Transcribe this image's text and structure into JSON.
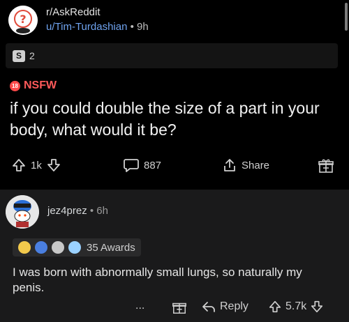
{
  "post": {
    "subreddit": "r/AskReddit",
    "author": "u/Tim-Turdashian",
    "age": "9h",
    "flair_count": "2",
    "flair_icon_glyph": "S",
    "nsfw_badge": "18",
    "nsfw_label": "NSFW",
    "title": "if you could double the size of a part in your body, what would it be?",
    "votes": "1k",
    "comments": "887",
    "share_label": "Share"
  },
  "comment": {
    "author": "jez4prez",
    "age": "6h",
    "awards_label": "35 Awards",
    "body": "I was born with abnormally small lungs, so naturally my penis.",
    "more_label": "...",
    "reply_label": "Reply",
    "votes": "5.7k"
  },
  "colors": {
    "background": "#000000",
    "comment_background": "#1a1a1b",
    "author_link": "#6fa3ef",
    "nsfw": "#ff5a5a",
    "text": "#d7dadc"
  },
  "icons": [
    "question-mark-icon",
    "flair-s-icon",
    "nsfw-badge-icon",
    "upvote-icon",
    "downvote-icon",
    "comment-icon",
    "share-icon",
    "award-gift-icon",
    "reply-icon",
    "more-icon"
  ]
}
